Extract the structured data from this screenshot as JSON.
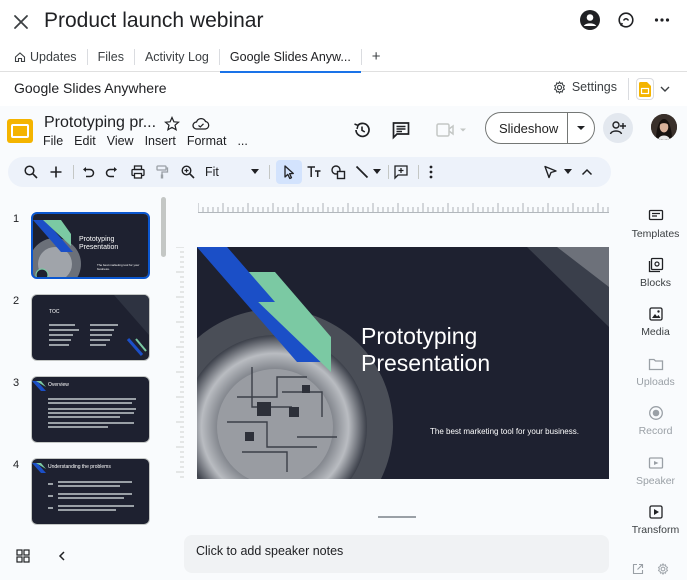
{
  "window": {
    "title": "Product launch webinar"
  },
  "tabs": [
    {
      "label": "Updates"
    },
    {
      "label": "Files"
    },
    {
      "label": "Activity Log"
    },
    {
      "label": "Google Slides Anyw..."
    },
    {
      "label": "+"
    }
  ],
  "app_header": {
    "name": "Google Slides Anywhere",
    "settings_label": "Settings"
  },
  "document": {
    "title": "Prototyping pr...",
    "menu": [
      "File",
      "Edit",
      "View",
      "Insert",
      "Format",
      "..."
    ]
  },
  "toolbar": {
    "zoom": "Fit",
    "slideshow_label": "Slideshow"
  },
  "filmstrip": {
    "slides": [
      {
        "number": "1",
        "title": "Prototyping Presentation",
        "subtitle": "The best marketing tool for your business."
      },
      {
        "number": "2",
        "title": "TOC"
      },
      {
        "number": "3",
        "title": "Overview"
      },
      {
        "number": "4",
        "title": "Understanding the problems"
      }
    ]
  },
  "slide": {
    "title_line1": "Prototyping",
    "title_line2": "Presentation",
    "subtitle": "The best marketing tool for your business."
  },
  "notes": {
    "placeholder": "Click to add speaker notes"
  },
  "right_panel": [
    {
      "label": "Templates",
      "icon": "templates-icon",
      "enabled": true
    },
    {
      "label": "Blocks",
      "icon": "blocks-icon",
      "enabled": true
    },
    {
      "label": "Media",
      "icon": "media-icon",
      "enabled": true
    },
    {
      "label": "Uploads",
      "icon": "uploads-icon",
      "enabled": false
    },
    {
      "label": "Record",
      "icon": "record-icon",
      "enabled": false
    },
    {
      "label": "Speaker",
      "icon": "speaker-icon",
      "enabled": false
    },
    {
      "label": "Transform",
      "icon": "transform-icon",
      "enabled": true
    }
  ],
  "colors": {
    "accent": "#1a73e8",
    "slide_bg": "#1e2130",
    "slide_blue": "#1b4fc7",
    "slide_green": "#7bc9a3",
    "slides_yellow": "#f4b400"
  }
}
